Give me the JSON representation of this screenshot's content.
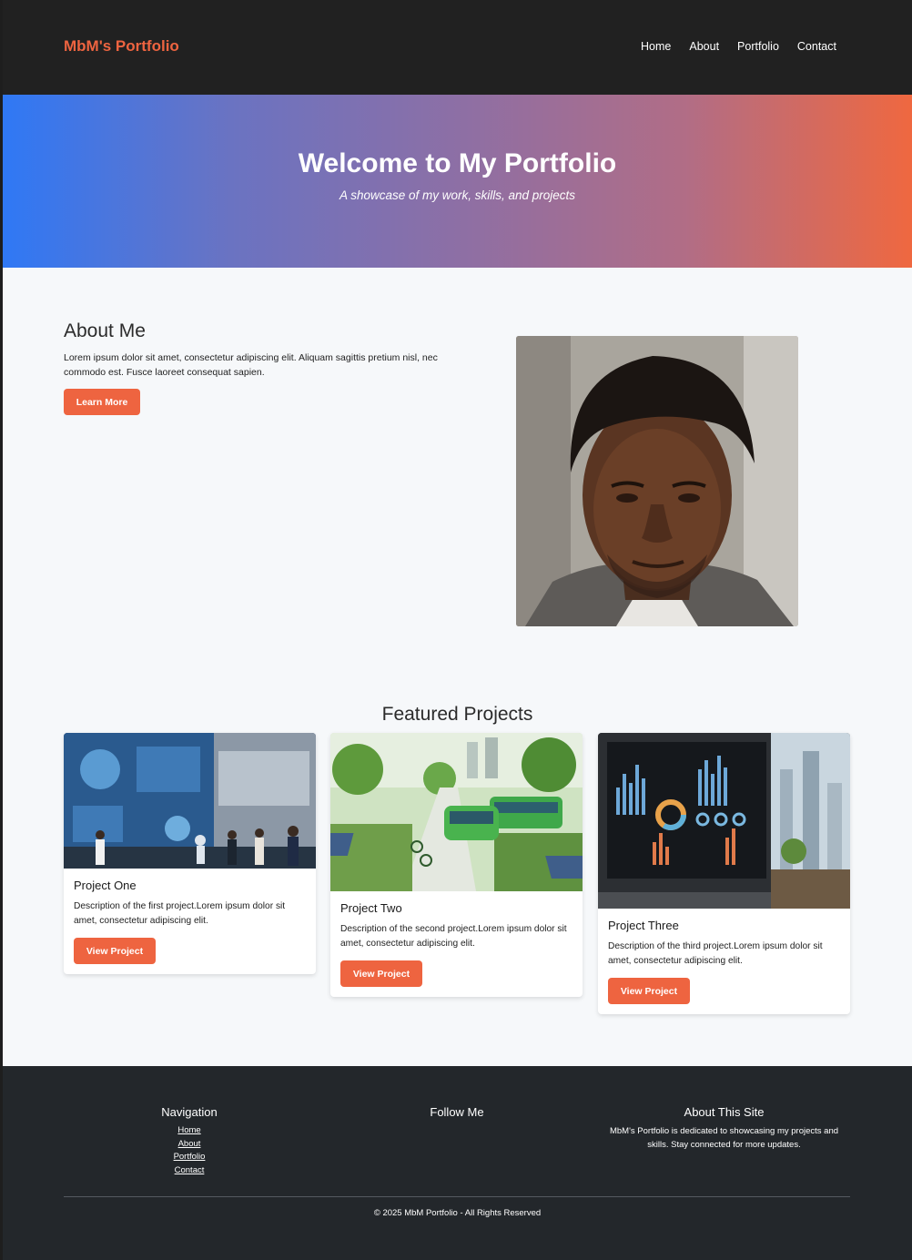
{
  "header": {
    "brand": "MbM's Portfolio",
    "nav": [
      "Home",
      "About",
      "Portfolio",
      "Contact"
    ]
  },
  "hero": {
    "title": "Welcome to My Portfolio",
    "subtitle": "A showcase of my work, skills, and projects"
  },
  "about": {
    "title": "About Me",
    "text": "Lorem ipsum dolor sit amet, consectetur adipiscing elit. Aliquam sagittis pretium nisl, nec commodo est. Fusce laoreet consequat sapien.",
    "button": "Learn More"
  },
  "projects": {
    "title": "Featured Projects",
    "items": [
      {
        "title": "Project One",
        "description": "Description of the first project.Lorem ipsum dolor sit amet, consectetur adipiscing elit.",
        "button": "View Project"
      },
      {
        "title": "Project Two",
        "description": "Description of the second project.Lorem ipsum dolor sit amet, consectetur adipiscing elit.",
        "button": "View Project"
      },
      {
        "title": "Project Three",
        "description": "Description of the third project.Lorem ipsum dolor sit amet, consectetur adipiscing elit.",
        "button": "View Project"
      }
    ]
  },
  "footer": {
    "navigation_title": "Navigation",
    "links": [
      "Home",
      "About",
      "Portfolio",
      "Contact"
    ],
    "follow_title": "Follow Me",
    "about_title": "About This Site",
    "about_text": "MbM's Portfolio is dedicated to showcasing my projects and skills. Stay connected for more updates.",
    "copyright": "© 2025 MbM Portfolio - All Rights Reserved"
  },
  "colors": {
    "accent": "#ee6440",
    "header_bg": "#212121",
    "footer_bg": "#23272b",
    "hero_start": "#2f78f5",
    "hero_end": "#ef6840"
  }
}
